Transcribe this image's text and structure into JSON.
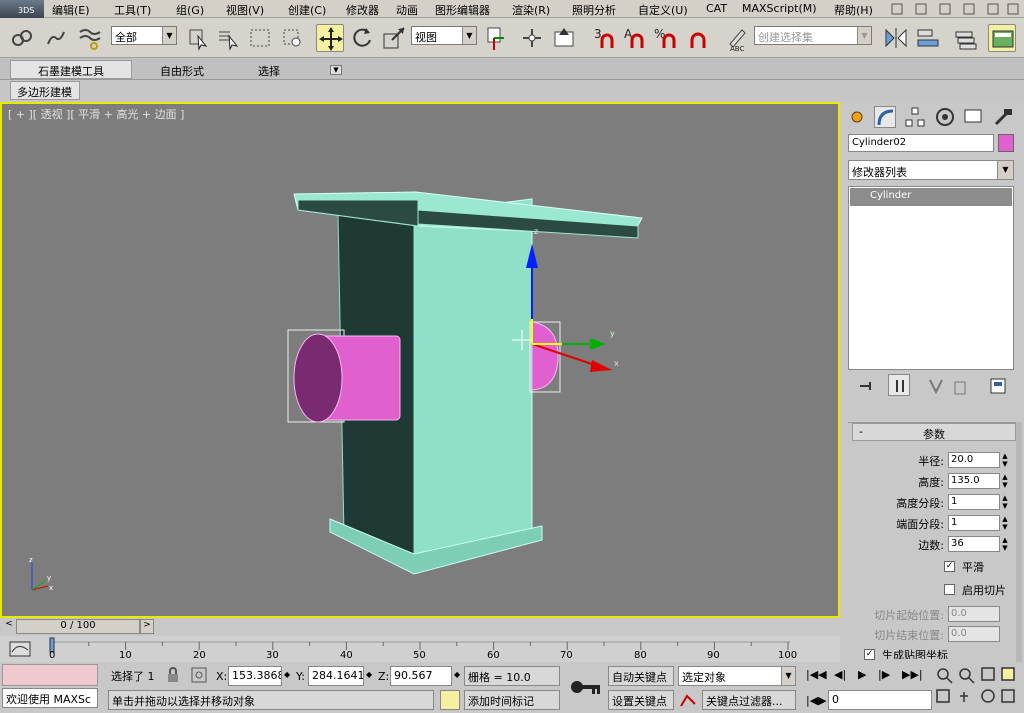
{
  "menubar": {
    "logo": "3DS",
    "items": [
      "编辑(E)",
      "工具(T)",
      "组(G)",
      "视图(V)",
      "创建(C)",
      "修改器",
      "动画",
      "图形编辑器",
      "渲染(R)",
      "照明分析",
      "自定义(U)",
      "CAT",
      "MAXScript(M)",
      "帮助(H)"
    ]
  },
  "toolbar": {
    "filter_select": "全部",
    "refcoord_select": "视图",
    "snap_label": "3",
    "angle_label": "A",
    "percent_label": "%",
    "named_sel_placeholder": "创建选择集"
  },
  "ribbon": {
    "tabs": [
      "石墨建模工具",
      "自由形式",
      "选择"
    ],
    "subtab": "多边形建模"
  },
  "viewport": {
    "label": "[ + ][ 透视 ][ 平滑 + 高光 + 边面 ]",
    "gizmo_x": "x",
    "gizmo_y": "y",
    "gizmo_z": "z"
  },
  "cmdpanel": {
    "object_name": "Cylinder02",
    "object_color": "#e060d0",
    "modifier_list": "修改器列表",
    "stack_item": "Cylinder",
    "rollout_title": "参数",
    "params": [
      {
        "label": "半径:",
        "value": "20.0"
      },
      {
        "label": "高度:",
        "value": "135.0"
      },
      {
        "label": "高度分段:",
        "value": "1"
      },
      {
        "label": "端面分段:",
        "value": "1"
      },
      {
        "label": "边数:",
        "value": "36"
      }
    ],
    "smooth_label": "平滑",
    "smooth_checked": true,
    "slice_label": "启用切片",
    "slice_from_label": "切片起始位置:",
    "slice_from_value": "0.0",
    "slice_to_label": "切片结束位置:",
    "slice_to_value": "0.0",
    "gen_uv_label": "生成贴图坐标"
  },
  "timeline": {
    "slider": "0 / 100",
    "ticks": [
      "0",
      "10",
      "20",
      "30",
      "40",
      "50",
      "60",
      "70",
      "80",
      "90",
      "100"
    ]
  },
  "status": {
    "welcome": "欢迎使用 MAXSc",
    "selected": "选择了 1",
    "prompt": "单击并拖动以选择并移动对象",
    "x_label": "X:",
    "x_value": "153.3868",
    "y_label": "Y:",
    "y_value": "284.1641",
    "z_label": "Z:",
    "z_value": "90.567",
    "grid": "栅格 = 10.0",
    "add_time_tag": "添加时间标记",
    "auto_key": "自动关键点",
    "set_key": "设置关键点",
    "key_mode_select": "选定对象",
    "key_filters": "关键点过滤器...",
    "frame": "0"
  }
}
